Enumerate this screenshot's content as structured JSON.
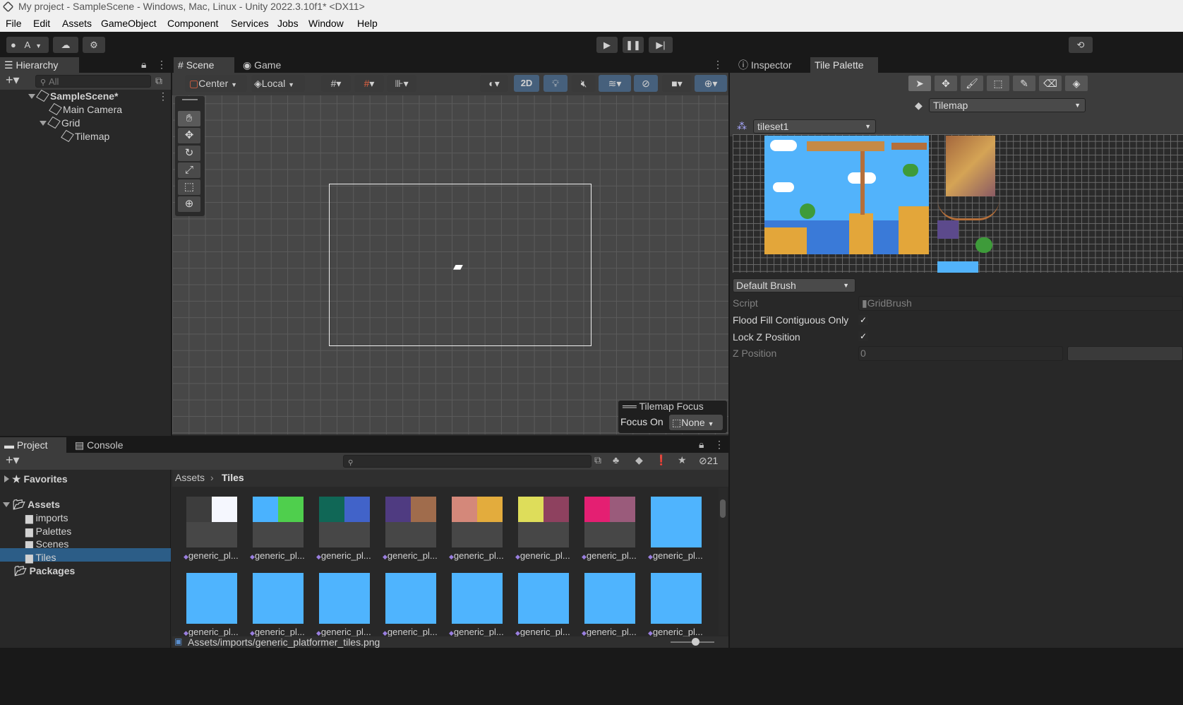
{
  "window": {
    "title": "My project - SampleScene - Windows, Mac, Linux - Unity 2022.3.10f1* <DX11>"
  },
  "menu": [
    "File",
    "Edit",
    "Assets",
    "GameObject",
    "Component",
    "Services",
    "Jobs",
    "Window",
    "Help"
  ],
  "toolbar": {
    "account": "A"
  },
  "hierarchy": {
    "tab": "Hierarchy",
    "search_placeholder": "All",
    "scene": "SampleScene*",
    "items": [
      "Main Camera",
      "Grid",
      "Tilemap"
    ]
  },
  "scene": {
    "tabs": [
      "Scene",
      "Game"
    ],
    "pivot": "Center",
    "space": "Local",
    "mode2d": "2D",
    "focus_title": "Tilemap Focus",
    "focus_on_label": "Focus On",
    "focus_value": "None"
  },
  "inspector": {
    "tabs": [
      "Inspector",
      "Tile Palette"
    ],
    "active_tilemap": "Tilemap",
    "palette": "tileset1",
    "brush": "Default Brush",
    "props": {
      "script_label": "Script",
      "script_value": "GridBrush",
      "flood_label": "Flood Fill Contiguous Only",
      "lockz_label": "Lock Z Position",
      "zpos_label": "Z Position",
      "zpos_value": "0"
    }
  },
  "project": {
    "tabs": [
      "Project",
      "Console"
    ],
    "favorites": "Favorites",
    "assets": "Assets",
    "folders": [
      "imports",
      "Palettes",
      "Scenes",
      "Tiles"
    ],
    "packages": "Packages",
    "breadcrumb": [
      "Assets",
      "Tiles"
    ],
    "hidden_count": "21",
    "status_path": "Assets/imports/generic_platformer_tiles.png",
    "tile_label": "generic_pl...",
    "tile_colors": [
      [
        "#3d3d3d",
        "#f5f7fe"
      ],
      [
        "#4ab2fe",
        "#4fcf4d"
      ],
      [
        "#106756",
        "#4163c9"
      ],
      [
        "#4f3b81",
        "#a06c4c"
      ],
      [
        "#d4887a",
        "#e3ac3d"
      ],
      [
        "#dedd5a",
        "#8e415f"
      ],
      [
        "#e41f72",
        "#9a5b7b"
      ],
      [
        "#4fb4fe",
        "#4fb4fe"
      ]
    ]
  }
}
